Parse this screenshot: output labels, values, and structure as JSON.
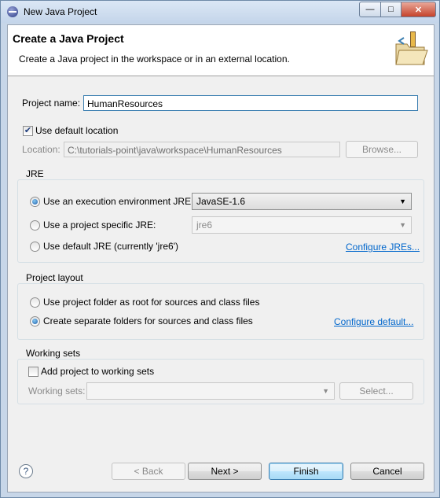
{
  "window": {
    "title": "New Java Project"
  },
  "header": {
    "title": "Create a Java Project",
    "description": "Create a Java project in the workspace or in an external location."
  },
  "project": {
    "name_label": "Project name:",
    "name_value": "HumanResources",
    "use_default_location_label": "Use default location",
    "use_default_location_checked": true,
    "location_label": "Location:",
    "location_value": "C:\\tutorials-point\\java\\workspace\\HumanResources",
    "browse_label": "Browse..."
  },
  "jre": {
    "group_title": "JRE",
    "option_env_label": "Use an execution environment JRE:",
    "option_env_value": "JavaSE-1.6",
    "option_specific_label": "Use a project specific JRE:",
    "option_specific_value": "jre6",
    "option_default_label": "Use default JRE (currently 'jre6')",
    "configure_link": "Configure JREs...",
    "selected": "execution-environment"
  },
  "layout": {
    "group_title": "Project layout",
    "option_root_label": "Use project folder as root for sources and class files",
    "option_separate_label": "Create separate folders for sources and class files",
    "configure_link": "Configure default...",
    "selected": "separate"
  },
  "working_sets": {
    "group_title": "Working sets",
    "add_label": "Add project to working sets",
    "add_checked": false,
    "sets_label": "Working sets:",
    "sets_value": "",
    "select_label": "Select..."
  },
  "footer": {
    "help_glyph": "?",
    "back_label": "< Back",
    "next_label": "Next >",
    "finish_label": "Finish",
    "cancel_label": "Cancel"
  },
  "colors": {
    "link": "#0066cc",
    "accent": "#3c7fb1"
  },
  "icons": [
    "eclipse-app-icon",
    "minimize-icon",
    "maximize-icon",
    "close-icon",
    "new-java-project-banner-icon",
    "help-icon",
    "dropdown-arrow-icon"
  ]
}
